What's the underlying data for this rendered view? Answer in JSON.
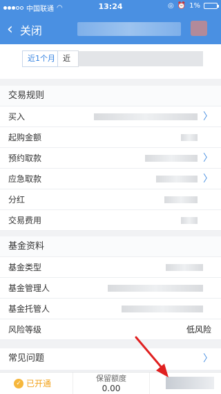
{
  "status": {
    "carrier": "中国联通",
    "time": "13:24",
    "battery": "1%"
  },
  "nav": {
    "back_label": "关闭"
  },
  "periods": {
    "tab1": "近1个月",
    "tab2": "近"
  },
  "trade_rules": {
    "title": "交易规则",
    "items": [
      {
        "label": "买入",
        "has_arrow": true
      },
      {
        "label": "起购金额",
        "has_arrow": false
      },
      {
        "label": "预约取款",
        "has_arrow": true
      },
      {
        "label": "应急取款",
        "has_arrow": true
      },
      {
        "label": "分红",
        "has_arrow": false
      },
      {
        "label": "交易费用",
        "has_arrow": false
      }
    ]
  },
  "fund_info": {
    "title": "基金资料",
    "items": [
      {
        "label": "基金类型"
      },
      {
        "label": "基金管理人"
      },
      {
        "label": "基金托管人"
      },
      {
        "label": "风险等级",
        "value": "低风险"
      }
    ]
  },
  "faq": {
    "label": "常见问题"
  },
  "bottom": {
    "opened_label": "已开通",
    "reserve_label": "保留额度",
    "reserve_value": "0.00"
  },
  "colors": {
    "accent": "#4a90e2",
    "opened": "#f2a21b",
    "annotation": "#e02020"
  }
}
